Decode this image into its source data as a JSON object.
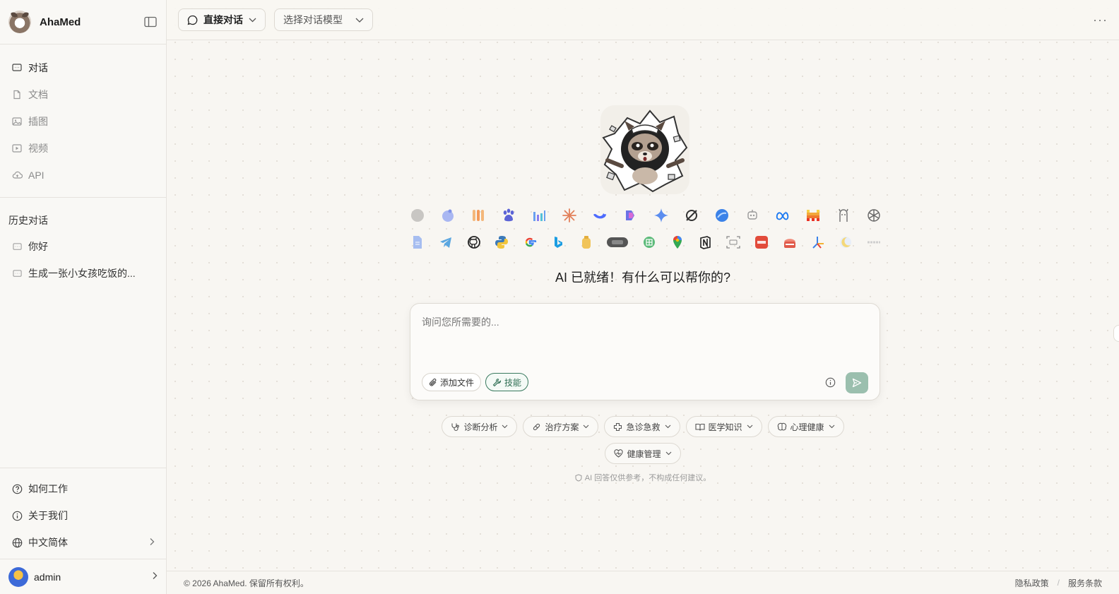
{
  "app": {
    "name": "AhaMed"
  },
  "sidebar": {
    "nav": [
      {
        "label": "对话",
        "icon": "chat-icon",
        "active": true
      },
      {
        "label": "文档",
        "icon": "document-icon",
        "active": false
      },
      {
        "label": "插图",
        "icon": "image-icon",
        "active": false
      },
      {
        "label": "视频",
        "icon": "video-icon",
        "active": false
      },
      {
        "label": "API",
        "icon": "cloud-icon",
        "active": false
      }
    ],
    "history_title": "历史对话",
    "history": [
      {
        "label": "你好"
      },
      {
        "label": "生成一张小女孩吃饭的..."
      }
    ],
    "bottom_links": [
      {
        "label": "如何工作",
        "icon": "help-circle-icon"
      },
      {
        "label": "关于我们",
        "icon": "info-icon"
      },
      {
        "label": "中文简体",
        "icon": "globe-icon"
      }
    ],
    "user": {
      "name": "admin"
    }
  },
  "topbar": {
    "mode_label": "直接对话",
    "model_placeholder": "选择对话模型",
    "more": "···"
  },
  "main": {
    "greeting": "AI 已就绪！有什么可以帮你的?",
    "composer": {
      "placeholder": "询问您所需要的...",
      "add_file": "添加文件",
      "skills": "技能"
    },
    "quick_actions": [
      {
        "label": "诊断分析",
        "icon": "stethoscope-icon"
      },
      {
        "label": "治疗方案",
        "icon": "pill-icon"
      },
      {
        "label": "急诊急救",
        "icon": "plus-cross-icon"
      },
      {
        "label": "医学知识",
        "icon": "book-icon"
      },
      {
        "label": "心理健康",
        "icon": "brain-icon"
      },
      {
        "label": "健康管理",
        "icon": "heart-icon"
      }
    ],
    "disclaimer": "AI 回答仅供参考，不构成任何建议。",
    "model_icons_row1": [
      "grey-blob-icon",
      "kimi-icon",
      "wenxin-icon",
      "baidu-paw-icon",
      "bar-chart-icon",
      "claude-star-icon",
      "deepseek-whale-icon",
      "copilot-icon",
      "gemini-star-icon",
      "grok-icon",
      "dola-icon",
      "robot-icon",
      "meta-icon",
      "mistral-icon",
      "alpaca-icon",
      "openai-icon"
    ],
    "model_icons_row2": [
      "doc-icon",
      "telegram-icon",
      "github-icon",
      "python-icon",
      "google-icon",
      "bing-icon",
      "bottle-icon",
      "pill-badge-icon",
      "sheets-icon",
      "maps-pin-icon",
      "notion-icon",
      "ocr-icon",
      "pdf-icon",
      "cake-icon",
      "arrow-branch-icon",
      "moon-icon",
      "text-icon"
    ]
  },
  "footer": {
    "copyright": "© 2026 AhaMed. 保留所有权利。",
    "privacy": "隐私政策",
    "terms": "服务条款",
    "separator": "/"
  },
  "colors": {
    "accent_green": "#2e6e53",
    "send_button": "#9bbfae",
    "background": "#f8f6f2"
  }
}
